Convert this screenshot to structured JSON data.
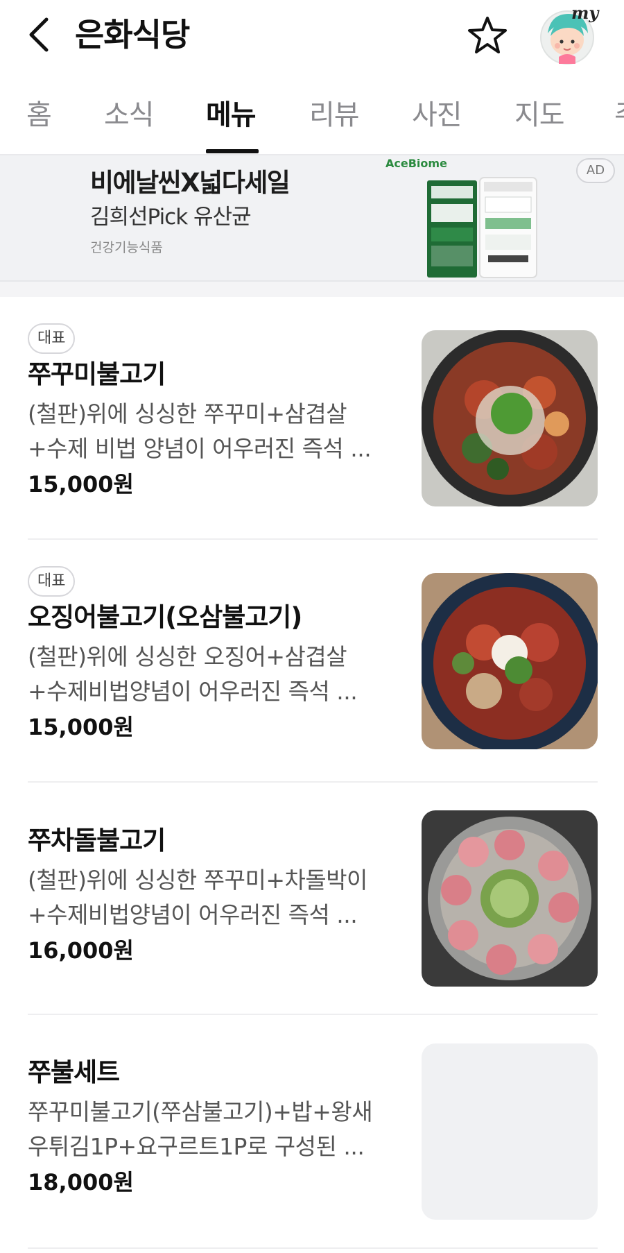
{
  "header": {
    "title": "은화식당",
    "back_icon": "chevron-left-icon",
    "favorite_icon": "star-outline-icon",
    "avatar_label": "my"
  },
  "tabs": [
    {
      "label": "홈",
      "active": false
    },
    {
      "label": "소식",
      "active": false
    },
    {
      "label": "메뉴",
      "active": true
    },
    {
      "label": "리뷰",
      "active": false
    },
    {
      "label": "사진",
      "active": false
    },
    {
      "label": "지도",
      "active": false
    },
    {
      "label": "주",
      "active": false
    }
  ],
  "ad": {
    "title": "비에날씬X넓다세일",
    "subtitle": "김희선Pick 유산균",
    "category": "건강기능식품",
    "brand": "AceBiome",
    "badge": "AD"
  },
  "menu": [
    {
      "badge": "대표",
      "name": "쭈꾸미불고기",
      "desc_line1": "(철판)위에 싱싱한 쭈꾸미+삼겹살",
      "desc_line2": "+수제 비법 양념이 어우러진 즉석 ...",
      "price": "15,000원"
    },
    {
      "badge": "대표",
      "name": "오징어불고기(오삼불고기)",
      "desc_line1": "(철판)위에 싱싱한 오징어+삼겹살",
      "desc_line2": "+수제비법양념이 어우러진 즉석 ...",
      "price": "15,000원"
    },
    {
      "badge": "",
      "name": "쭈차돌불고기",
      "desc_line1": "(철판)위에 싱싱한 쭈꾸미+차돌박이",
      "desc_line2": "+수제비법양념이 어우러진 즉석 ...",
      "price": "16,000원"
    },
    {
      "badge": "",
      "name": "쭈불세트",
      "desc_line1": "쭈꾸미불고기(쭈삼불고기)+밥+왕새",
      "desc_line2": "우튀김1P+요구르트1P로 구성된 ...",
      "price": "18,000원"
    }
  ],
  "colors": {
    "accent": "#111111",
    "ad_bg": "#f1f2f4",
    "brand_green": "#2a8a3e"
  }
}
